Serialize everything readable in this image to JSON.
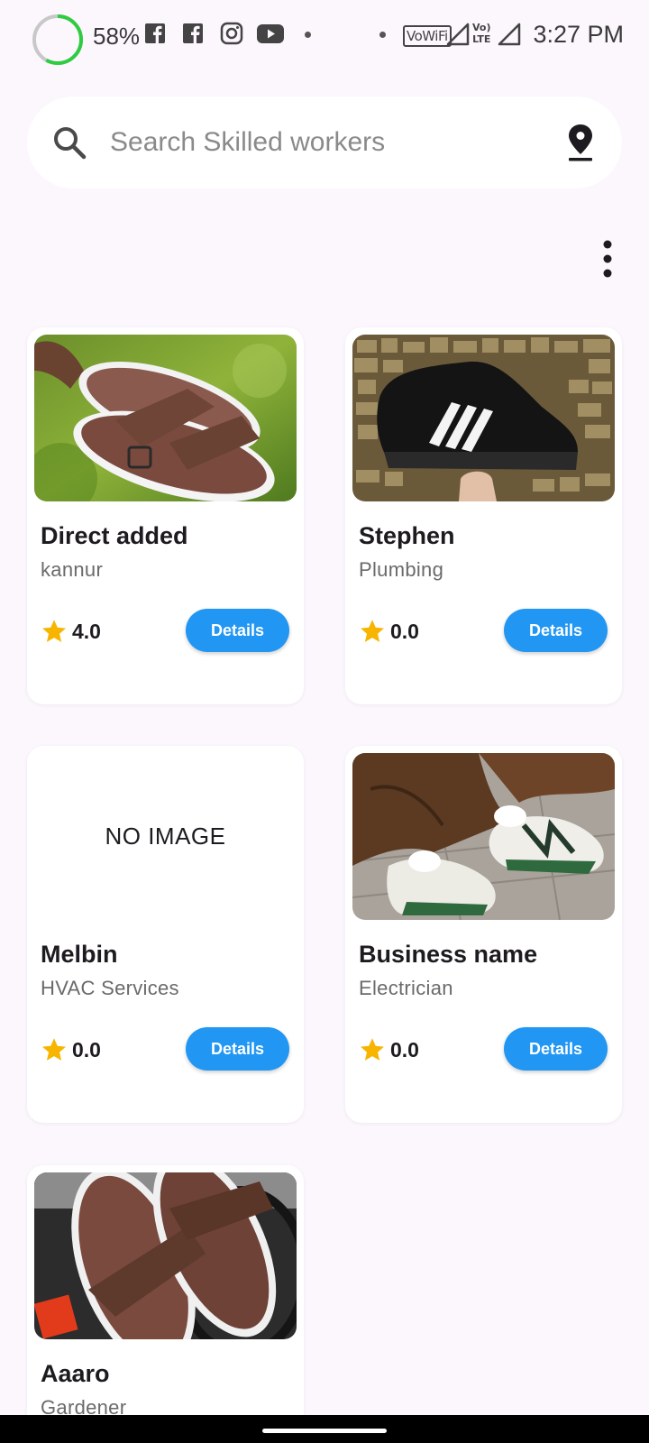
{
  "status_bar": {
    "battery_percent": "58%",
    "time": "3:27 PM",
    "vowifi_label": "VoWiFi",
    "lte_label_top": "Vo)",
    "lte_label_bottom": "LTE",
    "notification_icons": [
      "facebook-icon",
      "facebook-icon",
      "instagram-icon",
      "youtube-icon"
    ]
  },
  "search": {
    "placeholder": "Search Skilled workers"
  },
  "colors": {
    "background": "#fcf6fd",
    "accent": "#2196f3",
    "star": "#f7b500"
  },
  "cards": [
    {
      "name": "Direct added",
      "category": "kannur",
      "rating": "4.0",
      "button": "Details",
      "image": "brown-slides-photo"
    },
    {
      "name": "Stephen",
      "category": "Plumbing",
      "rating": "0.0",
      "button": "Details",
      "image": "black-sneaker-photo"
    },
    {
      "name": "Melbin",
      "category": "HVAC Services",
      "rating": "0.0",
      "button": "Details",
      "image_placeholder": "NO IMAGE"
    },
    {
      "name": "Business name",
      "category": "Electrician",
      "rating": "0.0",
      "button": "Details",
      "image": "green-sneakers-photo"
    },
    {
      "name": "Aaaro",
      "category": "Gardener",
      "image": "brown-slides-photo"
    }
  ]
}
